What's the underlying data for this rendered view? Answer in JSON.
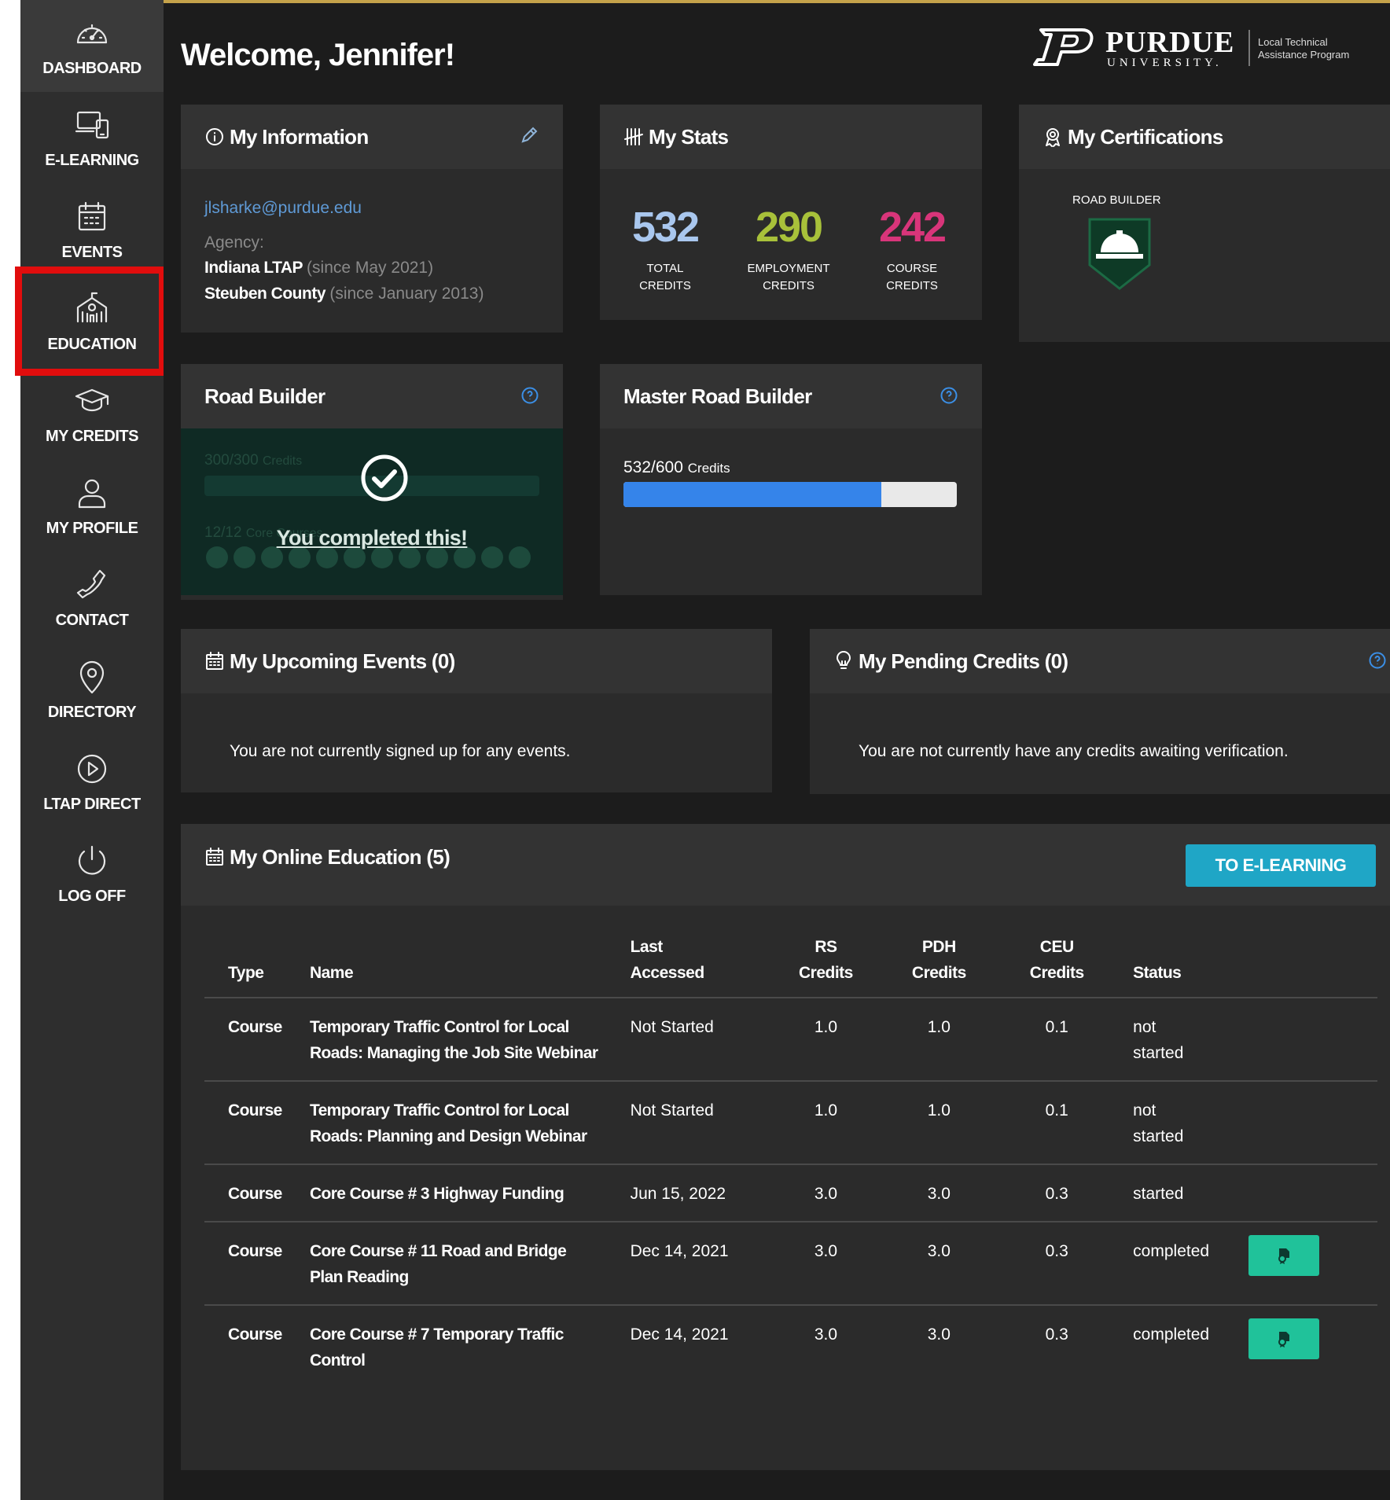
{
  "nav": {
    "items": [
      {
        "key": "dashboard",
        "label": "DASHBOARD",
        "icon": "speedometer-icon"
      },
      {
        "key": "elearning",
        "label": "E-LEARNING",
        "icon": "devices-icon"
      },
      {
        "key": "events",
        "label": "EVENTS",
        "icon": "calendar-icon"
      },
      {
        "key": "education",
        "label": "EDUCATION",
        "icon": "school-building-icon"
      },
      {
        "key": "credits",
        "label": "MY CREDITS",
        "icon": "graduation-cap-icon"
      },
      {
        "key": "profile",
        "label": "MY PROFILE",
        "icon": "person-icon"
      },
      {
        "key": "contact",
        "label": "CONTACT",
        "icon": "phone-icon"
      },
      {
        "key": "directory",
        "label": "DIRECTORY",
        "icon": "map-pin-icon"
      },
      {
        "key": "ltapdirect",
        "label": "LTAP DIRECT",
        "icon": "play-circle-icon"
      },
      {
        "key": "logoff",
        "label": "LOG OFF",
        "icon": "power-icon"
      }
    ]
  },
  "header": {
    "welcome": "Welcome, Jennifer!",
    "logo_word": "PURDUE",
    "logo_sub": "UNIVERSITY.",
    "logo_tag1": "Local Technical",
    "logo_tag2": "Assistance Program"
  },
  "info": {
    "title": "My Information",
    "email": "jlsharke@purdue.edu",
    "agency_label": "Agency:",
    "agency1": "Indiana LTAP",
    "agency1_since": "(since May 2021)",
    "agency2": "Steuben County",
    "agency2_since": "(since January 2013)"
  },
  "stats": {
    "title": "My Stats",
    "total": "532",
    "total_l1": "TOTAL",
    "total_l2": "CREDITS",
    "employment": "290",
    "employment_l1": "EMPLOYMENT",
    "employment_l2": "CREDITS",
    "course": "242",
    "course_l1": "COURSE",
    "course_l2": "CREDITS",
    "colors": {
      "total": "#a9c7ee",
      "employment": "#a8c13a",
      "course": "#d8357a"
    }
  },
  "certs": {
    "title": "My Certifications",
    "badge_label": "ROAD BUILDER"
  },
  "road_builder": {
    "title": "Road Builder",
    "credits_faint": "300/300",
    "credits_faint_unit": "Credits",
    "courses_faint": "12/12",
    "courses_faint_unit": "Core Courses",
    "completed": "You completed this!"
  },
  "master": {
    "title": "Master Road Builder",
    "credits_value": "532/600",
    "credits_unit": "Credits",
    "progress_fraction": 0.773
  },
  "events": {
    "title": "My Upcoming Events (0)",
    "empty": "You are not currently signed up for any events."
  },
  "pending": {
    "title": "My Pending Credits (0)",
    "empty": "You are not currently have any credits awaiting verification."
  },
  "online": {
    "title": "My Online Education (5)",
    "button": "TO E-LEARNING",
    "headers": {
      "type": "Type",
      "name": "Name",
      "last1": "Last",
      "last2": "Accessed",
      "rs1": "RS",
      "rs2": "Credits",
      "pdh1": "PDH",
      "pdh2": "Credits",
      "ceu1": "CEU",
      "ceu2": "Credits",
      "status": "Status"
    },
    "rows": [
      {
        "type": "Course",
        "name": "Temporary Traffic Control for Local Roads: Managing the Job Site Webinar",
        "last": "Not Started",
        "rs": "1.0",
        "pdh": "1.0",
        "ceu": "0.1",
        "status": "not started",
        "cert": false
      },
      {
        "type": "Course",
        "name": "Temporary Traffic Control for Local Roads: Planning and Design Webinar",
        "last": "Not Started",
        "rs": "1.0",
        "pdh": "1.0",
        "ceu": "0.1",
        "status": "not started",
        "cert": false
      },
      {
        "type": "Course",
        "name": "Core Course # 3 Highway Funding",
        "last": "Jun 15, 2022",
        "rs": "3.0",
        "pdh": "3.0",
        "ceu": "0.3",
        "status": "started",
        "cert": false
      },
      {
        "type": "Course",
        "name": "Core Course # 11 Road and Bridge Plan Reading",
        "last": "Dec 14, 2021",
        "rs": "3.0",
        "pdh": "3.0",
        "ceu": "0.3",
        "status": "completed",
        "cert": true
      },
      {
        "type": "Course",
        "name": "Core Course # 7 Temporary Traffic Control",
        "last": "Dec 14, 2021",
        "rs": "3.0",
        "pdh": "3.0",
        "ceu": "0.3",
        "status": "completed",
        "cert": true
      }
    ]
  }
}
